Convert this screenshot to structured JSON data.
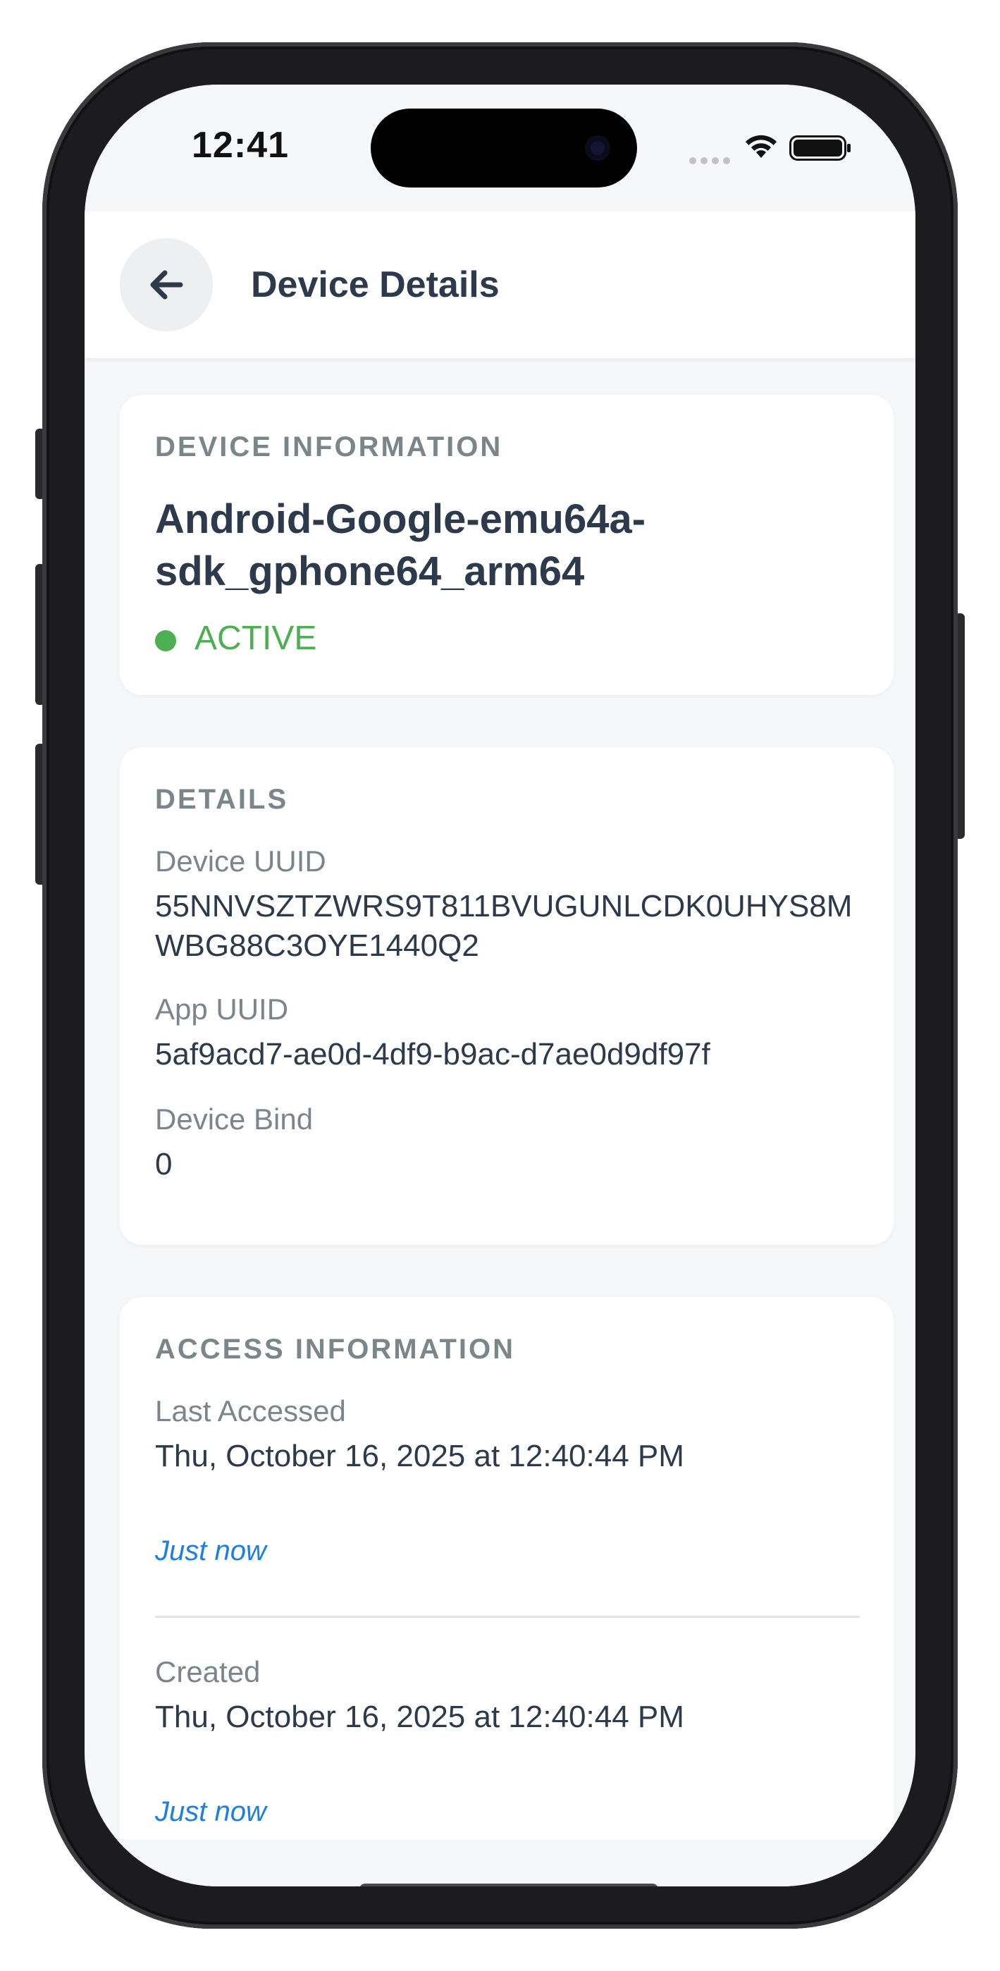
{
  "status_bar": {
    "time": "12:41",
    "wifi_icon": "wifi-icon",
    "battery_icon": "battery-icon"
  },
  "header": {
    "back_icon": "arrow-left-icon",
    "title": "Device Details"
  },
  "device_info": {
    "section_title": "DEVICE INFORMATION",
    "name": "Android-Google-emu64a-sdk_gphone64_arm64",
    "status": "ACTIVE",
    "status_color": "#4caf50"
  },
  "details": {
    "section_title": "DETAILS",
    "device_uuid_label": "Device UUID",
    "device_uuid": "55NNVSZTZWRS9T811BVUGUNLCDK0UHYS8MWBG88C3OYE1440Q2",
    "app_uuid_label": "App UUID",
    "app_uuid": "5af9acd7-ae0d-4df9-b9ac-d7ae0d9df97f",
    "device_bind_label": "Device Bind",
    "device_bind": "0"
  },
  "access_info": {
    "section_title": "ACCESS INFORMATION",
    "last_accessed_label": "Last Accessed",
    "last_accessed": "Thu, October 16, 2025 at 12:40:44 PM",
    "last_accessed_relative": "Just now",
    "created_label": "Created",
    "created": "Thu, October 16, 2025 at 12:40:44 PM",
    "created_relative": "Just now"
  },
  "colors": {
    "accent_link": "#1f7fe0",
    "text_primary": "#2d3a4b",
    "text_muted": "#7c858c",
    "background": "#f6f7f9"
  }
}
